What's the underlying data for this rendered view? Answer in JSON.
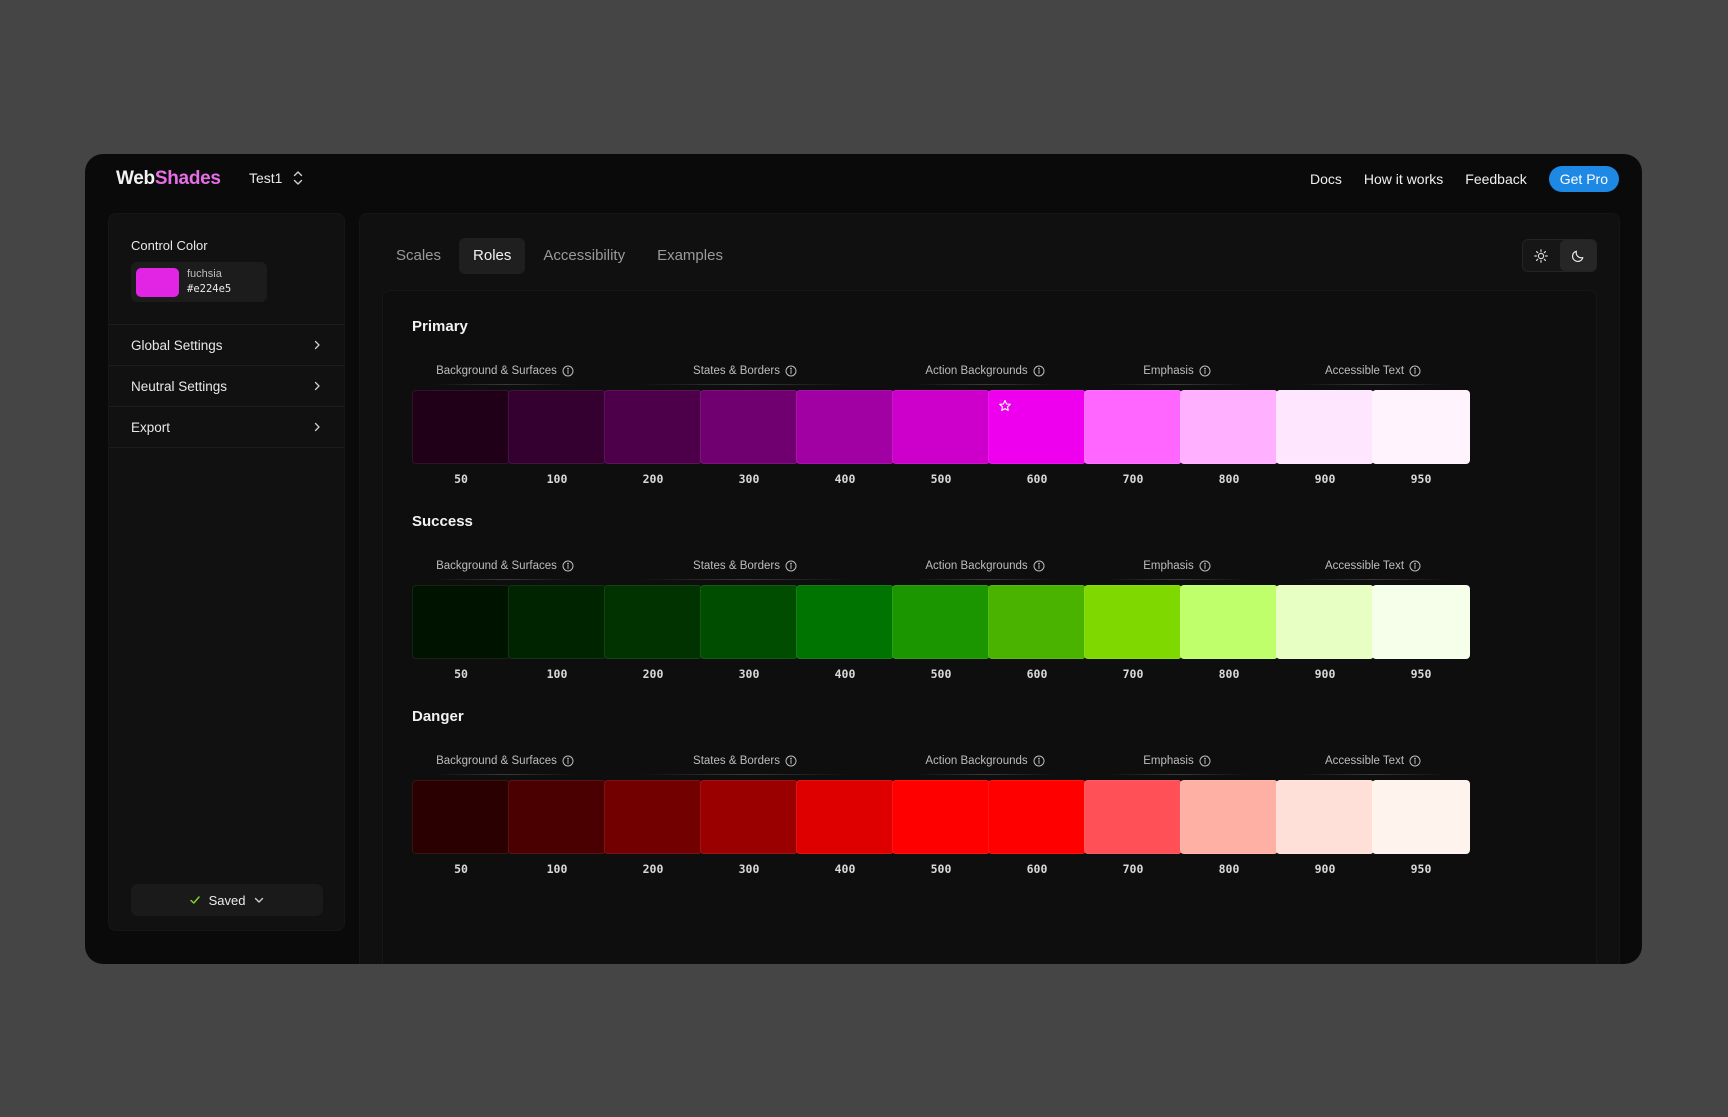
{
  "brand": {
    "part1": "Web",
    "part2": "Shades"
  },
  "project": {
    "name": "Test1"
  },
  "nav": {
    "docs": "Docs",
    "how": "How it works",
    "feedback": "Feedback",
    "pro": "Get Pro"
  },
  "sidebar": {
    "control_label": "Control Color",
    "color": {
      "name": "fuchsia",
      "hex": "#e224e5"
    },
    "items": [
      {
        "label": "Global Settings"
      },
      {
        "label": "Neutral Settings"
      },
      {
        "label": "Export"
      }
    ],
    "saved_label": "Saved"
  },
  "tabs": [
    {
      "label": "Scales",
      "active": false
    },
    {
      "label": "Roles",
      "active": true
    },
    {
      "label": "Accessibility",
      "active": false
    },
    {
      "label": "Examples",
      "active": false
    }
  ],
  "theme": {
    "light_icon": "sun-icon",
    "dark_icon": "moon-icon",
    "selected": "dark"
  },
  "group_labels": [
    "Background & Surfaces",
    "States & Borders",
    "Action Backgrounds",
    "Emphasis",
    "Accessible Text"
  ],
  "shades": [
    "50",
    "100",
    "200",
    "300",
    "400",
    "500",
    "600",
    "700",
    "800",
    "900",
    "950"
  ],
  "roles": [
    {
      "name": "Primary",
      "starred_index": 6,
      "colors": [
        "#1f0018",
        "#330030",
        "#4d0049",
        "#700070",
        "#a100a2",
        "#cc00ca",
        "#ee00ee",
        "#ff66ff",
        "#ffb0ff",
        "#ffe6ff",
        "#fff4fe"
      ]
    },
    {
      "name": "Success",
      "starred_index": -1,
      "colors": [
        "#001300",
        "#002300",
        "#003300",
        "#004d00",
        "#007400",
        "#1c9600",
        "#4ab300",
        "#7fd800",
        "#bfff6b",
        "#e8ffc4",
        "#f5ffea"
      ]
    },
    {
      "name": "Danger",
      "starred_index": -1,
      "colors": [
        "#2b0000",
        "#4a0000",
        "#720000",
        "#9a0000",
        "#de0000",
        "#ff0000",
        "#ff0000",
        "#ff5057",
        "#ffb0a5",
        "#ffe0d8",
        "#fff3ee"
      ]
    }
  ]
}
